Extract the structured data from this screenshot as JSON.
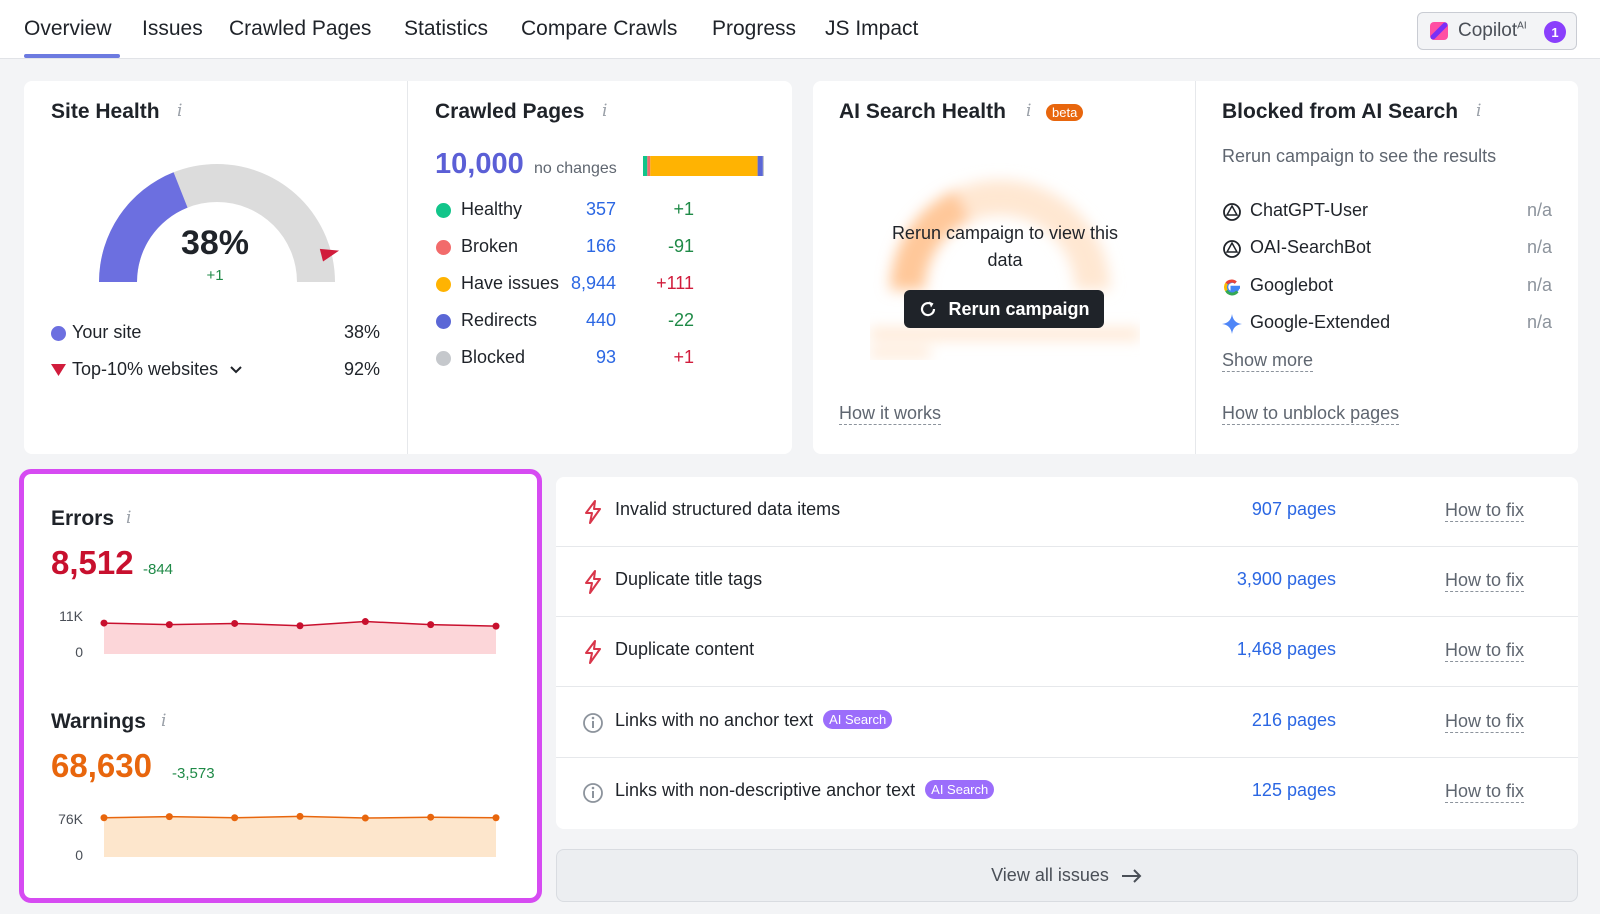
{
  "nav": {
    "tabs": [
      "Overview",
      "Issues",
      "Crawled Pages",
      "Statistics",
      "Compare Crawls",
      "Progress",
      "JS Impact"
    ],
    "copilot_label": "Copilot",
    "copilot_sup": "AI",
    "copilot_badge": "1"
  },
  "site_health": {
    "title": "Site Health",
    "info": "i",
    "score": "38%",
    "score_delta": "+1",
    "score_fraction": 0.38,
    "top10_fraction": 0.92,
    "legend": [
      {
        "label": "Your site",
        "value": "38%",
        "color": "#6c6fe0"
      },
      {
        "label": "Top-10% websites",
        "value": "92%",
        "color": "#d11c3c"
      }
    ]
  },
  "crawled_pages": {
    "title": "Crawled Pages",
    "info": "i",
    "total": "10,000",
    "total_note": "no changes",
    "rows": [
      {
        "label": "Healthy",
        "value": "357",
        "delta": "+1",
        "delta_color": "#1f8a47",
        "color": "#12c58a"
      },
      {
        "label": "Broken",
        "value": "166",
        "delta": "-91",
        "delta_color": "#1f8a47",
        "color": "#f26b6b"
      },
      {
        "label": "Have issues",
        "value": "8,944",
        "delta": "+111",
        "delta_color": "#d11c3c",
        "color": "#ffb302"
      },
      {
        "label": "Redirects",
        "value": "440",
        "delta": "-22",
        "delta_color": "#1f8a47",
        "color": "#5b67d6"
      },
      {
        "label": "Blocked",
        "value": "93",
        "delta": "+1",
        "delta_color": "#d11c3c",
        "color": "#c5c8cc"
      }
    ]
  },
  "ai_search_health": {
    "title": "AI Search Health",
    "info": "i",
    "beta": "beta",
    "message": "Rerun campaign to view this data",
    "button": "Rerun campaign",
    "link": "How it works"
  },
  "blocked_ai": {
    "title": "Blocked from AI Search",
    "info": "i",
    "subtitle": "Rerun campaign to see the results",
    "bots": [
      {
        "name": "ChatGPT-User",
        "value": "n/a",
        "icon": "openai-icon"
      },
      {
        "name": "OAI-SearchBot",
        "value": "n/a",
        "icon": "openai-icon"
      },
      {
        "name": "Googlebot",
        "value": "n/a",
        "icon": "google-icon"
      },
      {
        "name": "Google-Extended",
        "value": "n/a",
        "icon": "gemini-icon"
      }
    ],
    "show_more": "Show more",
    "link": "How to unblock pages"
  },
  "errors": {
    "title": "Errors",
    "info": "i",
    "value": "8,512",
    "delta": "-844",
    "axis_top": "11K",
    "axis_bottom": "0",
    "color": "#c8102e"
  },
  "warnings": {
    "title": "Warnings",
    "info": "i",
    "value": "68,630",
    "delta": "-3,573",
    "axis_top": "76K",
    "axis_bottom": "0",
    "color": "#e8660d"
  },
  "chart_data": [
    {
      "type": "area",
      "title": "Errors",
      "ylim": [
        0,
        11000
      ],
      "values": [
        8100,
        7700,
        8000,
        7400,
        8500,
        7700,
        7300
      ]
    },
    {
      "type": "area",
      "title": "Warnings",
      "ylim": [
        0,
        76000
      ],
      "values": [
        71000,
        73000,
        71000,
        73500,
        70500,
        72000,
        71000
      ]
    }
  ],
  "issues": [
    {
      "name": "Invalid structured data items",
      "tag": "",
      "pages": "907 pages",
      "fix": "How to fix",
      "kind": "error"
    },
    {
      "name": "Duplicate title tags",
      "tag": "",
      "pages": "3,900 pages",
      "fix": "How to fix",
      "kind": "error"
    },
    {
      "name": "Duplicate content",
      "tag": "",
      "pages": "1,468 pages",
      "fix": "How to fix",
      "kind": "error"
    },
    {
      "name": "Links with no anchor text",
      "tag": "AI Search",
      "pages": "216 pages",
      "fix": "How to fix",
      "kind": "notice"
    },
    {
      "name": "Links with non-descriptive anchor text",
      "tag": "AI Search",
      "pages": "125 pages",
      "fix": "How to fix",
      "kind": "notice"
    }
  ],
  "view_all": "View all issues"
}
